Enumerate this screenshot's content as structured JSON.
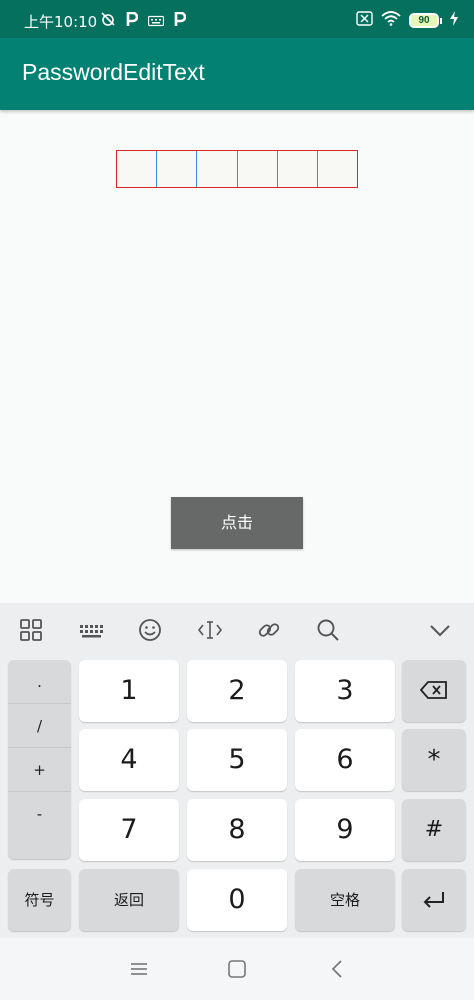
{
  "status_bar": {
    "time": "上午10:10",
    "left_icons": [
      "alarm-off-icon",
      "parking-p-icon",
      "keyboard-icon",
      "parking-p-icon"
    ],
    "right_icons": [
      "sim-off-icon",
      "wifi-icon",
      "battery-icon",
      "charging-icon"
    ],
    "battery_level": "90"
  },
  "app_bar": {
    "title": "PasswordEditText"
  },
  "password_field": {
    "cells": 6,
    "border_color": "#e02424",
    "divider_color": "#3a8fd6"
  },
  "action_button": {
    "label": "点击"
  },
  "keyboard": {
    "toolbar_icons": [
      "grid-icon",
      "keyboard-icon",
      "emoji-icon",
      "cursor-icon",
      "link-icon",
      "search-icon",
      "chevron-down-icon"
    ],
    "symbols": [
      ".",
      "/",
      "+",
      "-"
    ],
    "digits": {
      "1": "1",
      "2": "2",
      "3": "3",
      "4": "4",
      "5": "5",
      "6": "6",
      "7": "7",
      "8": "8",
      "9": "9",
      "0": "0"
    },
    "backspace_icon": "backspace-icon",
    "star": "*",
    "hash": "#",
    "enter_icon": "enter-icon",
    "symbols_key": "符号",
    "back_key": "返回",
    "space_key": "空格"
  },
  "nav_bar": {
    "icons": [
      "menu-icon",
      "home-square-icon",
      "back-chevron-icon"
    ]
  },
  "colors": {
    "status_bar": "#06705f",
    "app_bar": "#038273",
    "button": "#666968",
    "keyboard_bg": "#eceeef"
  }
}
